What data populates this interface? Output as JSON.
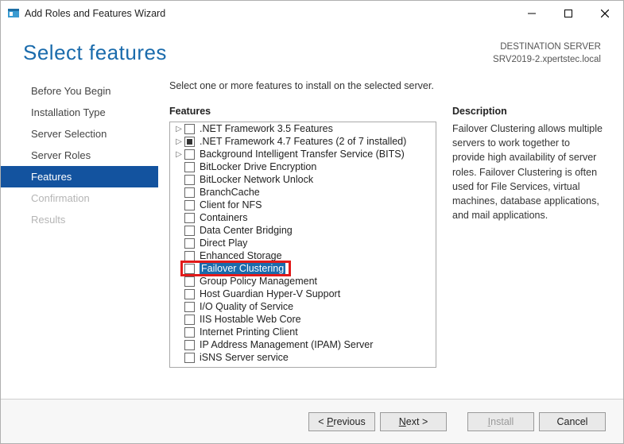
{
  "window": {
    "title": "Add Roles and Features Wizard"
  },
  "header": {
    "title": "Select features",
    "dest_label": "DESTINATION SERVER",
    "dest_value": "SRV2019-2.xpertstec.local"
  },
  "nav": {
    "items": [
      {
        "label": "Before You Begin",
        "state": "normal"
      },
      {
        "label": "Installation Type",
        "state": "normal"
      },
      {
        "label": "Server Selection",
        "state": "normal"
      },
      {
        "label": "Server Roles",
        "state": "normal"
      },
      {
        "label": "Features",
        "state": "active"
      },
      {
        "label": "Confirmation",
        "state": "disabled"
      },
      {
        "label": "Results",
        "state": "disabled"
      }
    ]
  },
  "main": {
    "intro": "Select one or more features to install on the selected server.",
    "features_label": "Features",
    "features": [
      {
        "label": ".NET Framework 3.5 Features",
        "expandable": true,
        "checked": false
      },
      {
        "label": ".NET Framework 4.7 Features (2 of 7 installed)",
        "expandable": true,
        "checked": "partial"
      },
      {
        "label": "Background Intelligent Transfer Service (BITS)",
        "expandable": true,
        "checked": false
      },
      {
        "label": "BitLocker Drive Encryption",
        "expandable": false,
        "checked": false
      },
      {
        "label": "BitLocker Network Unlock",
        "expandable": false,
        "checked": false
      },
      {
        "label": "BranchCache",
        "expandable": false,
        "checked": false
      },
      {
        "label": "Client for NFS",
        "expandable": false,
        "checked": false
      },
      {
        "label": "Containers",
        "expandable": false,
        "checked": false
      },
      {
        "label": "Data Center Bridging",
        "expandable": false,
        "checked": false
      },
      {
        "label": "Direct Play",
        "expandable": false,
        "checked": false
      },
      {
        "label": "Enhanced Storage",
        "expandable": false,
        "checked": false
      },
      {
        "label": "Failover Clustering",
        "expandable": false,
        "checked": false,
        "selected": true,
        "highlighted": true
      },
      {
        "label": "Group Policy Management",
        "expandable": false,
        "checked": false
      },
      {
        "label": "Host Guardian Hyper-V Support",
        "expandable": false,
        "checked": false
      },
      {
        "label": "I/O Quality of Service",
        "expandable": false,
        "checked": false
      },
      {
        "label": "IIS Hostable Web Core",
        "expandable": false,
        "checked": false
      },
      {
        "label": "Internet Printing Client",
        "expandable": false,
        "checked": false
      },
      {
        "label": "IP Address Management (IPAM) Server",
        "expandable": false,
        "checked": false
      },
      {
        "label": "iSNS Server service",
        "expandable": false,
        "checked": false
      }
    ],
    "description_label": "Description",
    "description": "Failover Clustering allows multiple servers to work together to provide high availability of server roles. Failover Clustering is often used for File Services, virtual machines, database applications, and mail applications."
  },
  "footer": {
    "previous": "Previous",
    "next": "Next",
    "install": "Install",
    "cancel": "Cancel"
  }
}
